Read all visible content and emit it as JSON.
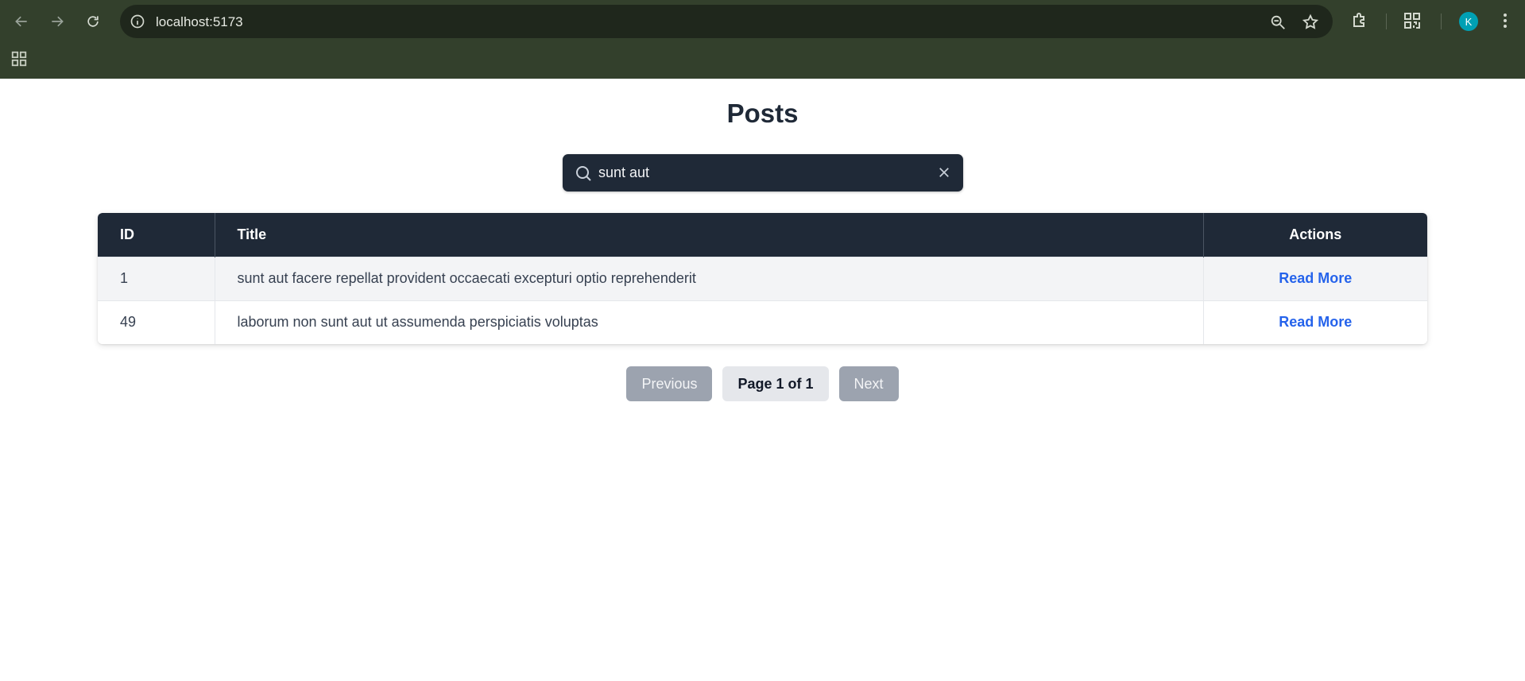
{
  "browser": {
    "url": "localhost:5173",
    "profile_initial": "K",
    "icons": {
      "back": "arrow-left-icon",
      "forward": "arrow-right-icon",
      "reload": "reload-icon",
      "site_info": "info-icon",
      "zoom": "zoom-out-icon",
      "bookmark": "star-icon",
      "extensions": "puzzle-icon",
      "qr": "qr-code-icon",
      "menu": "kebab-menu-icon",
      "apps": "apps-grid-icon"
    }
  },
  "page": {
    "title": "Posts"
  },
  "search": {
    "value": "sunt aut",
    "placeholder": ""
  },
  "table": {
    "columns": [
      "ID",
      "Title",
      "Actions"
    ],
    "rows": [
      {
        "id": "1",
        "title": "sunt aut facere repellat provident occaecati excepturi optio reprehenderit",
        "action": "Read More"
      },
      {
        "id": "49",
        "title": "laborum non sunt aut ut assumenda perspiciatis voluptas",
        "action": "Read More"
      }
    ]
  },
  "pagination": {
    "previous_label": "Previous",
    "page_label": "Page 1 of 1",
    "next_label": "Next",
    "current_page": 1,
    "total_pages": 1
  },
  "colors": {
    "chrome_bg": "#33402c",
    "header_bg": "#1f2937",
    "link": "#2563eb",
    "avatar": "#00a0b4"
  }
}
